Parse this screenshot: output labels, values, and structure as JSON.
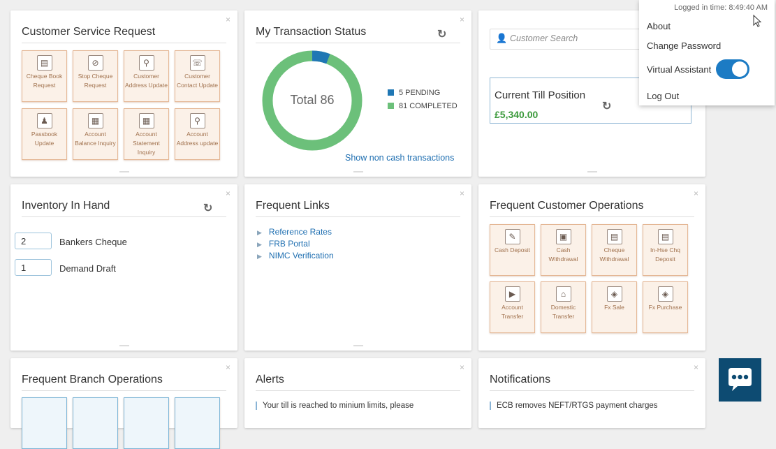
{
  "customer_service": {
    "title": "Customer Service Request",
    "close": "×",
    "tiles": [
      {
        "label": "Cheque Book Request",
        "icon": "▤"
      },
      {
        "label": "Stop Cheque Request",
        "icon": "⊘"
      },
      {
        "label": "Customer Address Update",
        "icon": "⚲"
      },
      {
        "label": "Customer Contact Update",
        "icon": "☏"
      },
      {
        "label": "Passbook Update",
        "icon": "♟"
      },
      {
        "label": "Account Balance Inquiry",
        "icon": "▦"
      },
      {
        "label": "Account Statement Inquiry",
        "icon": "▦"
      },
      {
        "label": "Account Address update",
        "icon": "⚲"
      }
    ]
  },
  "transaction_status": {
    "title": "My Transaction Status",
    "close": "×",
    "total_label": "Total 86",
    "pending_label": "5 PENDING",
    "completed_label": "81 COMPLETED",
    "pending_value": 5,
    "completed_value": 81,
    "pending_color": "#1f77b4",
    "completed_color": "#6cc07a",
    "link": "Show non cash transactions"
  },
  "till": {
    "search_placeholder": "Customer Search",
    "title": "Current Till Position",
    "amount": "£5,340.00"
  },
  "inventory": {
    "title": "Inventory In Hand",
    "close": "×",
    "items": [
      {
        "qty": "2",
        "label": "Bankers Cheque"
      },
      {
        "qty": "1",
        "label": "Demand Draft"
      }
    ]
  },
  "frequent_links": {
    "title": "Frequent Links",
    "close": "×",
    "links": [
      "Reference Rates",
      "FRB Portal",
      "NIMC Verification"
    ]
  },
  "customer_ops": {
    "title": "Frequent Customer Operations",
    "close": "×",
    "tiles": [
      {
        "label": "Cash Deposit",
        "icon": "✎"
      },
      {
        "label": "Cash Withdrawal",
        "icon": "▣"
      },
      {
        "label": "Cheque Withdrawal",
        "icon": "▤"
      },
      {
        "label": "In-Hse Chq Deposit",
        "icon": "▤"
      },
      {
        "label": "Account Transfer",
        "icon": "▶"
      },
      {
        "label": "Domestic Transfer",
        "icon": "⌂"
      },
      {
        "label": "Fx Sale",
        "icon": "◈"
      },
      {
        "label": "Fx Purchase",
        "icon": "◈"
      }
    ]
  },
  "branch_ops": {
    "title": "Frequent Branch Operations",
    "close": "×"
  },
  "alerts": {
    "title": "Alerts",
    "close": "×",
    "text": "Your till is reached to minium limits, please"
  },
  "notifications": {
    "title": "Notifications",
    "close": "×",
    "text": "ECB removes NEFT/RTGS payment charges"
  },
  "user_menu": {
    "logged_in": "Logged in time: 8:49:40 AM",
    "about": "About",
    "change_password": "Change Password",
    "virtual_assistant": "Virtual Assistant",
    "virtual_assistant_on": true,
    "logout": "Log Out"
  },
  "refresh_icon": "↻",
  "colors": {
    "accent": "#1c7bc4",
    "tile_border": "#e4b795",
    "amount_green": "#3c9a3c",
    "chat_bg": "#0d4b72"
  }
}
